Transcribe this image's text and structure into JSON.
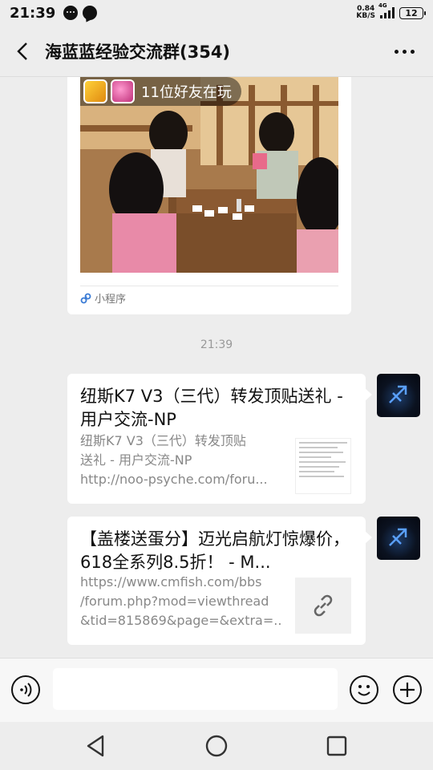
{
  "status_bar": {
    "time": "21:39",
    "net_speed_value": "0.84",
    "net_speed_unit": "KB/S",
    "signal_label": "4G",
    "battery": "12"
  },
  "header": {
    "title": "海蓝蓝经验交流群(354)"
  },
  "messages": {
    "mini_program": {
      "friends_text": "11位好友在玩",
      "tag": "小程序"
    },
    "time_divider": "21:39",
    "link1": {
      "title": "纽斯K7 V3（三代）转发顶贴送礼 - 用户交流-NP",
      "desc_line1": "纽斯K7 V3（三代）转发顶贴",
      "desc_line2": "送礼 - 用户交流-NP",
      "desc_line3": "http://noo-psyche.com/foru..."
    },
    "link2": {
      "title": "【盖楼送蛋分】迈光启航灯惊爆价，618全系列8.5折！ - M...",
      "desc_line1": "https://www.cmfish.com/bbs",
      "desc_line2": "/forum.php?mod=viewthread",
      "desc_line3": "&tid=815869&page=&extra=..."
    }
  },
  "icons": {
    "back": "back-arrow-icon",
    "more": "more-dots-icon",
    "voice": "voice-icon",
    "emoji": "emoji-icon",
    "plus": "plus-icon",
    "link": "link-icon",
    "mini_program": "mini-program-icon"
  },
  "colors": {
    "background": "#ededed",
    "bubble": "#ffffff",
    "text_primary": "#111111",
    "text_secondary": "#888888"
  }
}
